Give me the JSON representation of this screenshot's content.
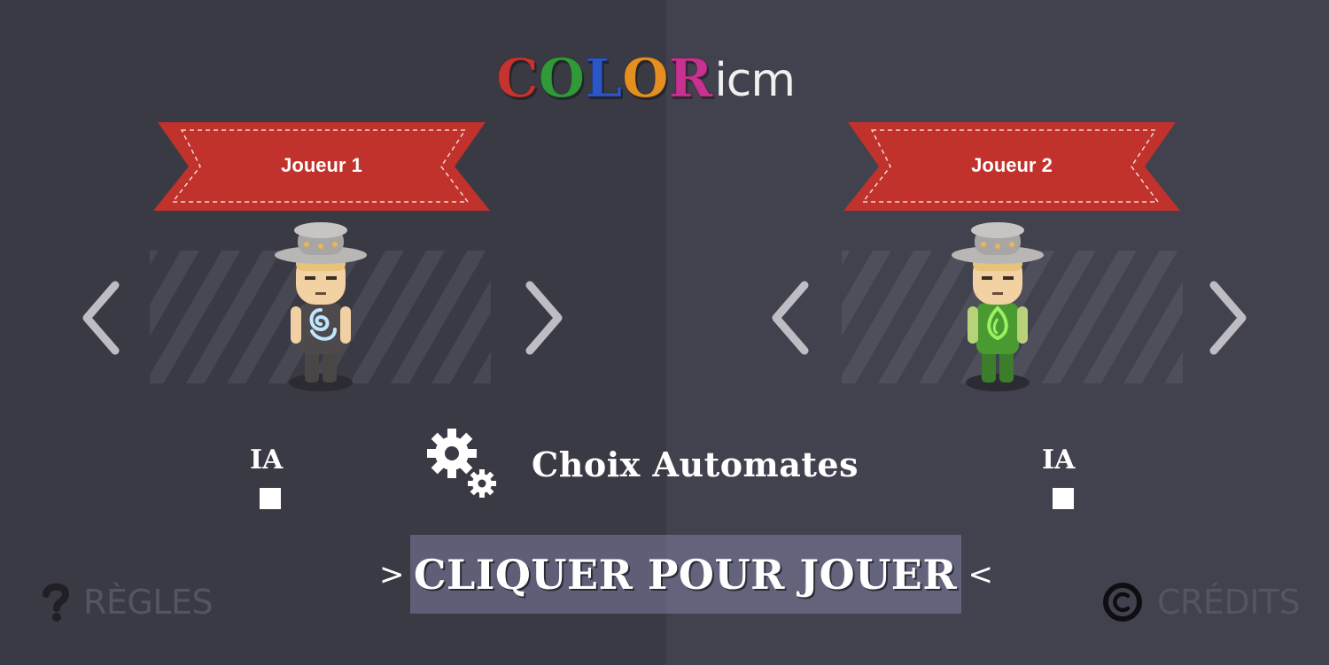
{
  "logo": {
    "letters": [
      {
        "char": "C",
        "color": "#c3332f"
      },
      {
        "char": "O",
        "color": "#2f9a37"
      },
      {
        "char": "L",
        "color": "#2c56c8"
      },
      {
        "char": "O",
        "color": "#e48f1f"
      },
      {
        "char": "R",
        "color": "#c7318f"
      }
    ],
    "suffix": "icm"
  },
  "players": [
    {
      "name": "Joueur 1",
      "ia_label": "IA",
      "ia_checked": false,
      "element_icon": "air-swirl-icon",
      "shirt_color": "#4e4a4b"
    },
    {
      "name": "Joueur 2",
      "ia_label": "IA",
      "ia_checked": false,
      "element_icon": "leaf-flame-icon",
      "shirt_color": "#3b7d2b"
    }
  ],
  "automates": {
    "label": "Choix Automates",
    "icon": "gears-icon"
  },
  "play": {
    "label": "CLIQUER POUR JOUER",
    "left_chevron": ">",
    "right_chevron": "<"
  },
  "footer": {
    "rules": {
      "label": "RÈGLES",
      "icon": "question-mark-icon"
    },
    "credits": {
      "label": "CRÉDITS",
      "icon": "copyright-icon"
    }
  },
  "colors": {
    "ribbon": "#c0322b",
    "arrow": "#bdbdc3",
    "muted_text": "#55555f"
  }
}
